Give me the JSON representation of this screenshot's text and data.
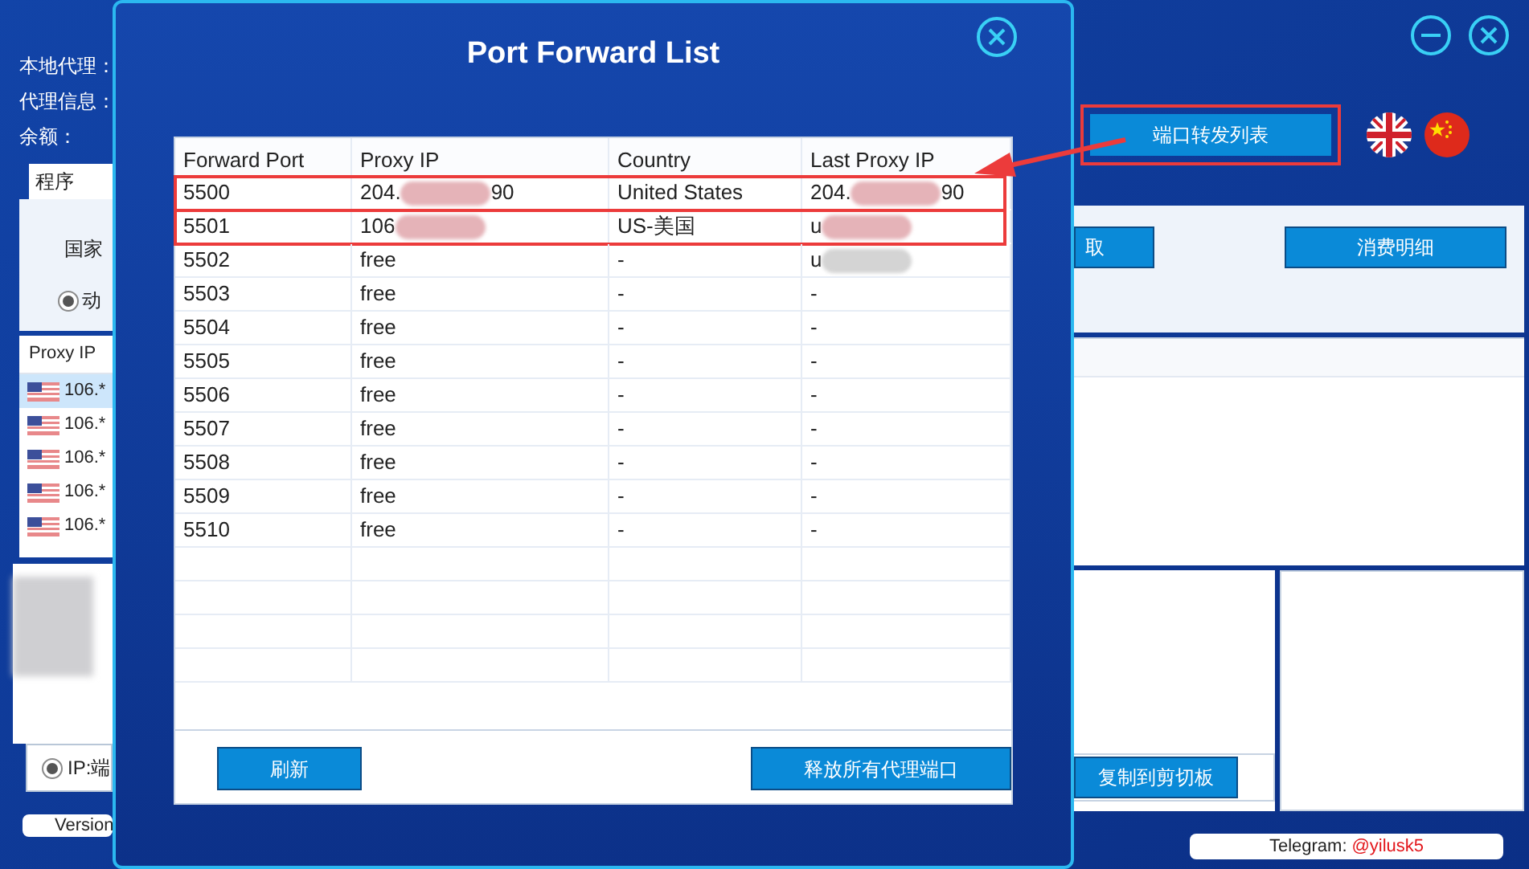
{
  "app": {
    "info_labels": [
      "本地代理：",
      "代理信息：",
      "余额："
    ],
    "tab": "程序",
    "country_label": "国家",
    "mode_radio": {
      "label": "动",
      "selected": true
    },
    "proxy_list": {
      "header": "Proxy IP",
      "rows": [
        {
          "ip": "106.*",
          "selected": true
        },
        {
          "ip": "106.*",
          "selected": false
        },
        {
          "ip": "106.*",
          "selected": false
        },
        {
          "ip": "106.*",
          "selected": false
        },
        {
          "ip": "106.*",
          "selected": false
        }
      ]
    },
    "ip_radio": {
      "label": "IP:端",
      "selected": true
    },
    "version": "Version",
    "port_list_button": {
      "label": "端口转发列表",
      "highlighted": true
    },
    "extract_button": "取",
    "spending_button": "消费明细",
    "copy_button": "复制到剪切板",
    "telegram": {
      "label": "Telegram:",
      "handle": "@yilusk5"
    }
  },
  "dialog": {
    "title": "Port Forward List",
    "columns": [
      "Forward Port",
      "Proxy IP",
      "Country",
      "Last Proxy IP"
    ],
    "rows": [
      {
        "port": "5500",
        "proxy_ip": {
          "head": "204.",
          "tail": "90",
          "redacted": true
        },
        "country": "United States",
        "last_proxy_ip": {
          "head": "204.",
          "tail": "90",
          "redacted": true
        },
        "highlighted": true
      },
      {
        "port": "5501",
        "proxy_ip": {
          "head": "106",
          "redacted": true
        },
        "country": "US-美国",
        "last_proxy_ip": {
          "head": "u",
          "redacted": true
        },
        "highlighted": true
      },
      {
        "port": "5502",
        "proxy_ip": {
          "head": "free",
          "redacted": false
        },
        "country": "-",
        "last_proxy_ip": {
          "head": "u",
          "redacted": true
        },
        "highlighted": false
      },
      {
        "port": "5503",
        "proxy_ip": {
          "head": "free",
          "redacted": false
        },
        "country": "-",
        "last_proxy_ip": {
          "head": "-",
          "redacted": false
        },
        "highlighted": false
      },
      {
        "port": "5504",
        "proxy_ip": {
          "head": "free",
          "redacted": false
        },
        "country": "-",
        "last_proxy_ip": {
          "head": "-",
          "redacted": false
        },
        "highlighted": false
      },
      {
        "port": "5505",
        "proxy_ip": {
          "head": "free",
          "redacted": false
        },
        "country": "-",
        "last_proxy_ip": {
          "head": "-",
          "redacted": false
        },
        "highlighted": false
      },
      {
        "port": "5506",
        "proxy_ip": {
          "head": "free",
          "redacted": false
        },
        "country": "-",
        "last_proxy_ip": {
          "head": "-",
          "redacted": false
        },
        "highlighted": false
      },
      {
        "port": "5507",
        "proxy_ip": {
          "head": "free",
          "redacted": false
        },
        "country": "-",
        "last_proxy_ip": {
          "head": "-",
          "redacted": false
        },
        "highlighted": false
      },
      {
        "port": "5508",
        "proxy_ip": {
          "head": "free",
          "redacted": false
        },
        "country": "-",
        "last_proxy_ip": {
          "head": "-",
          "redacted": false
        },
        "highlighted": false
      },
      {
        "port": "5509",
        "proxy_ip": {
          "head": "free",
          "redacted": false
        },
        "country": "-",
        "last_proxy_ip": {
          "head": "-",
          "redacted": false
        },
        "highlighted": false
      },
      {
        "port": "5510",
        "proxy_ip": {
          "head": "free",
          "redacted": false
        },
        "country": "-",
        "last_proxy_ip": {
          "head": "-",
          "redacted": false
        },
        "highlighted": false
      }
    ],
    "buttons": [
      "刷新",
      "释放所有代理端口"
    ]
  }
}
